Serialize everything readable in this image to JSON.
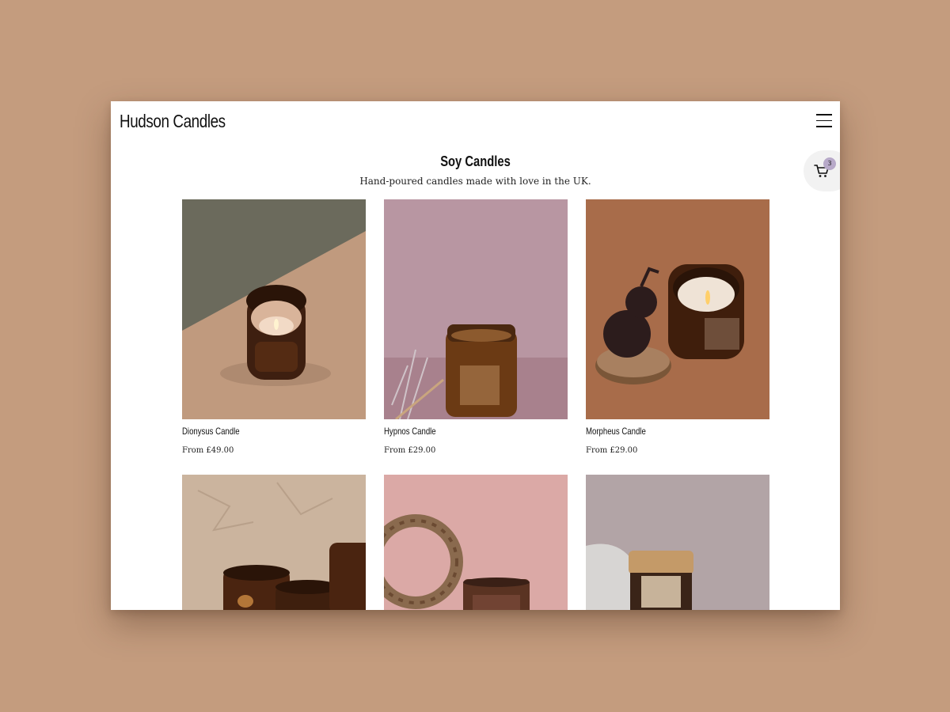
{
  "header": {
    "logo": "Hudson Candles"
  },
  "cart": {
    "count": "3"
  },
  "collection": {
    "title": "Soy Candles",
    "subtitle": "Hand-poured candles made with love in the UK."
  },
  "products": [
    {
      "name": "Dionysus Candle",
      "price": "From £49.00"
    },
    {
      "name": "Hypnos Candle",
      "price": "From £29.00"
    },
    {
      "name": "Morpheus Candle",
      "price": "From £29.00"
    }
  ],
  "colors": {
    "background": "#c49c7e",
    "cart_badge": "#b7a9c9"
  },
  "icons": {
    "menu": "hamburger-icon",
    "cart": "cart-icon"
  }
}
